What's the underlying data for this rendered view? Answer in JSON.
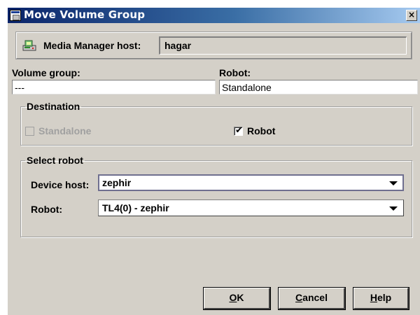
{
  "window": {
    "title": "Move Volume Group",
    "close_glyph": "×"
  },
  "media_manager": {
    "icon": "media-manager-host-icon",
    "label": "Media Manager host:",
    "value": "hagar"
  },
  "volume_group": {
    "label": "Volume group:",
    "value": "---"
  },
  "robot_field": {
    "label": "Robot:",
    "value": "Standalone"
  },
  "destination": {
    "legend": "Destination",
    "options": [
      {
        "label": "Standalone",
        "checked": false,
        "enabled": false
      },
      {
        "label": "Robot",
        "checked": true,
        "enabled": true
      }
    ]
  },
  "select_robot": {
    "legend": "Select robot",
    "device_host": {
      "label": "Device host:",
      "value": "zephir"
    },
    "robot": {
      "label": "Robot:",
      "value": "TL4(0) - zephir"
    }
  },
  "buttons": {
    "ok": {
      "mnemonic": "O",
      "rest": "K"
    },
    "cancel": {
      "mnemonic": "C",
      "rest": "ancel"
    },
    "help": {
      "mnemonic": "H",
      "rest": "elp"
    }
  },
  "colors": {
    "title_bar_start": "#0a246a",
    "title_bar_end": "#a6caf0",
    "dialog_bg": "#d4d0c8"
  }
}
